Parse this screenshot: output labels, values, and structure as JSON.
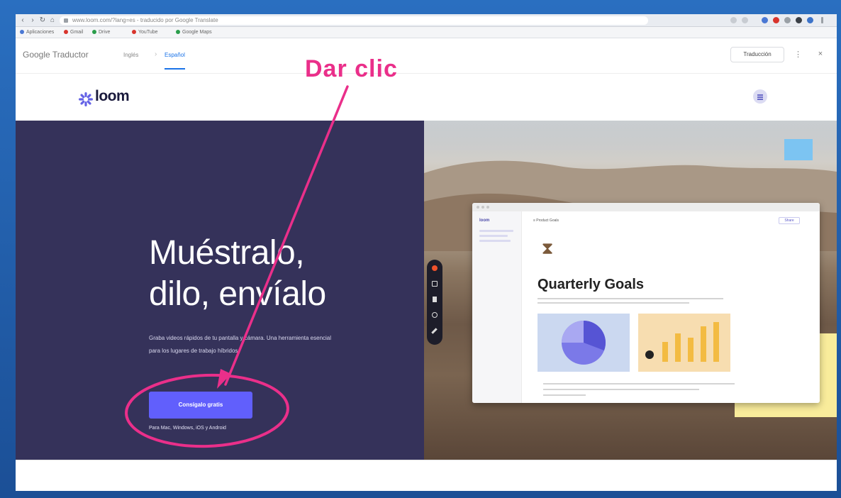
{
  "browser": {
    "address_text": "www.loom.com/?lang=es - traducido por Google Translate",
    "bookmarks": [
      "Aplicaciones",
      "Gmail",
      "Drive",
      "YouTube",
      "Google Maps"
    ]
  },
  "translate_bar": {
    "title": "Google Traductor",
    "original_lang": "Inglés",
    "translated_lang": "Español",
    "separator": "›",
    "original_button": "Traducción",
    "icons": [
      "grid-icon",
      "more-icon",
      "close-icon"
    ]
  },
  "loom": {
    "logo_text": "loom",
    "hero": {
      "title_line1": "Muéstralo,",
      "title_line2": "dilo, envíalo",
      "description": "Graba videos rápidos de tu pantalla y cámara. Una herramienta esencial para los lugares de trabajo híbridos.",
      "cta_label": "Consígalo gratis",
      "platforms": "Para Mac, Windows, iOS y Android"
    },
    "mockup": {
      "sidebar_logo": "loom",
      "breadcrumb": "≡ Product Goals",
      "share_label": "Share",
      "heading": "Quarterly Goals"
    }
  },
  "annotation": {
    "label": "Dar clic",
    "color": "#ea2f8a"
  },
  "colors": {
    "hero_bg": "#35325a",
    "cta_bg": "#615ffc",
    "accent": "#ea2f8a"
  }
}
